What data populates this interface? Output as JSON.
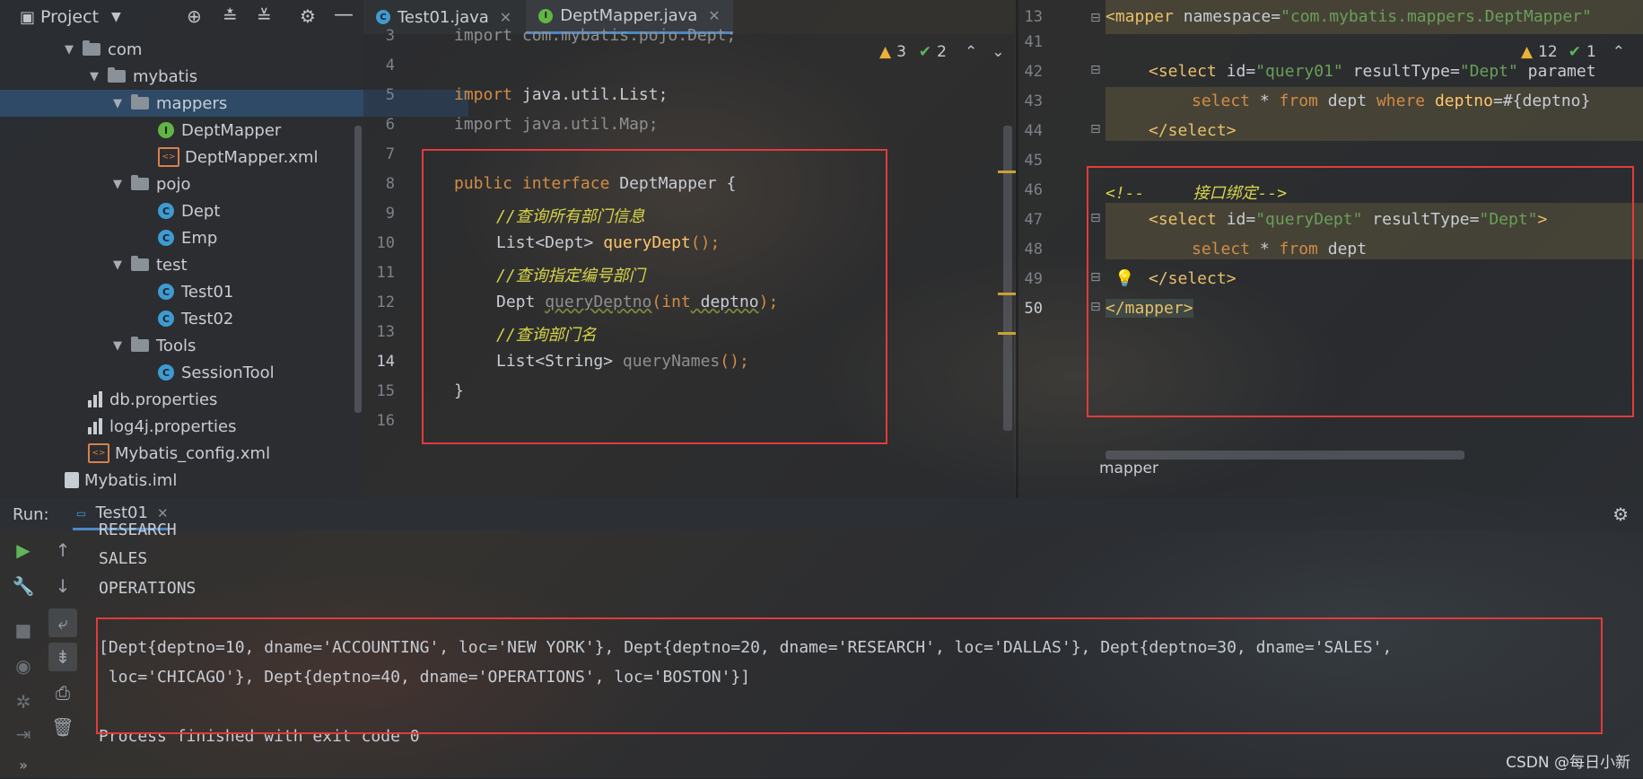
{
  "project_panel": {
    "title": "Project",
    "tree": [
      {
        "label": "com",
        "kind": "package",
        "expanded": true
      },
      {
        "label": "mybatis",
        "kind": "package",
        "expanded": true
      },
      {
        "label": "mappers",
        "kind": "package",
        "expanded": true,
        "selected": true
      },
      {
        "label": "DeptMapper",
        "kind": "interface"
      },
      {
        "label": "DeptMapper.xml",
        "kind": "xml"
      },
      {
        "label": "pojo",
        "kind": "package",
        "expanded": true
      },
      {
        "label": "Dept",
        "kind": "class"
      },
      {
        "label": "Emp",
        "kind": "class"
      },
      {
        "label": "test",
        "kind": "package",
        "expanded": true
      },
      {
        "label": "Test01",
        "kind": "class-runnable"
      },
      {
        "label": "Test02",
        "kind": "class-runnable"
      },
      {
        "label": "Tools",
        "kind": "package",
        "expanded": true
      },
      {
        "label": "SessionTool",
        "kind": "class"
      },
      {
        "label": "db.properties",
        "kind": "properties"
      },
      {
        "label": "log4j.properties",
        "kind": "properties"
      },
      {
        "label": "Mybatis_config.xml",
        "kind": "xml"
      },
      {
        "label": "Mybatis.iml",
        "kind": "iml"
      }
    ]
  },
  "tabs": [
    {
      "label": "Test01.java",
      "icon": "class-icon"
    },
    {
      "label": "DeptMapper.java",
      "icon": "interface-icon",
      "active": true
    }
  ],
  "java_editor": {
    "inspections": {
      "warnings": "3",
      "ok": "2"
    },
    "line_numbers": [
      "3",
      "4",
      "5",
      "6",
      "7",
      "8",
      "9",
      "10",
      "11",
      "12",
      "13",
      "14",
      "15",
      "16"
    ],
    "lines": {
      "l3": "import com.mybatis.pojo.Dept;",
      "l5_kw": "import",
      "l5_rest": " java.util.List;",
      "l6_kw": "import",
      "l6_rest": " java.util.Map;",
      "l8_kw1": "public",
      "l8_kw2": "interface",
      "l8_rest": " DeptMapper {",
      "l9_comment": "//查询所有部门信息",
      "l10_type": "List<Dept> ",
      "l10_fn": "queryDept",
      "l10_end": "();",
      "l11_comment": "//查询指定编号部门",
      "l12_type": "Dept ",
      "l12_fn": "queryDeptno",
      "l12_open": "(",
      "l12_kw": "int",
      "l12_param": " deptno",
      "l12_end": ");",
      "l13_comment": "//查询部门名",
      "l14_type": "List<String> ",
      "l14_fn": "queryNames",
      "l14_end": "();",
      "l15": "}"
    }
  },
  "xml_editor": {
    "inspections": {
      "warnings": "12",
      "ok": "1"
    },
    "line_numbers": [
      "13",
      "41",
      "42",
      "43",
      "44",
      "45",
      "46",
      "47",
      "48",
      "49",
      "50"
    ],
    "lines": {
      "l13_tag": "<mapper",
      "l13_attr": " namespace=",
      "l13_val": "\"com.mybatis.mappers.DeptMapper\"",
      "l42_tag": "<select",
      "l42_attr1": " id=",
      "l42_val1": "\"query01\"",
      "l42_attr2": " resultType=",
      "l42_val2": "\"Dept\"",
      "l42_attr3": " paramet",
      "l43_select": "select",
      "l43_star": " * ",
      "l43_from": "from",
      "l43_table": " dept ",
      "l43_where": "where",
      "l43_col": " deptno",
      "l43_rest": "=#{deptno}",
      "l44": "</select>",
      "l46": "<!--     接口绑定-->",
      "l47_tag": "<select",
      "l47_attr1": " id=",
      "l47_val1": "\"queryDept\"",
      "l47_attr2": " resultType=",
      "l47_val2": "\"Dept\"",
      "l47_close": ">",
      "l48_select": "select",
      "l48_star": " * ",
      "l48_from": "from",
      "l48_table": " dept",
      "l49": "</select>",
      "l50": "</mapper>"
    },
    "breadcrumb": "mapper"
  },
  "run_panel": {
    "label": "Run:",
    "tab": "Test01",
    "output": [
      "RESEARCH",
      "SALES",
      "OPERATIONS",
      "------------------------",
      "[Dept{deptno=10, dname='ACCOUNTING', loc='NEW YORK'}, Dept{deptno=20, dname='RESEARCH', loc='DALLAS'}, Dept{deptno=30, dname='SALES',",
      " loc='CHICAGO'}, Dept{deptno=40, dname='OPERATIONS', loc='BOSTON'}]",
      "",
      "Process finished with exit code 0"
    ]
  },
  "watermark": "CSDN @每日小新"
}
